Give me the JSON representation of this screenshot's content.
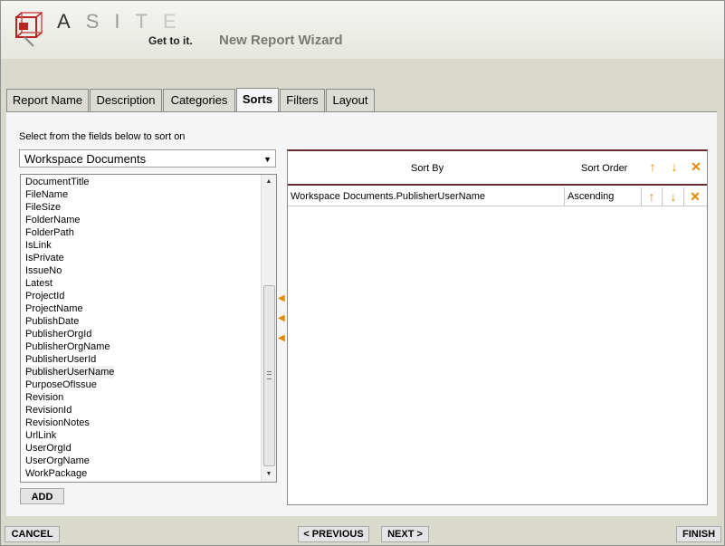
{
  "header": {
    "logo_letters": [
      "A",
      "S",
      "I",
      "T",
      "E"
    ],
    "tagline": "Get to it.",
    "wizard_title": "New Report Wizard"
  },
  "tabs": [
    {
      "label": "Report Name",
      "active": false
    },
    {
      "label": "Description",
      "active": false
    },
    {
      "label": "Categories",
      "active": false
    },
    {
      "label": "Sorts",
      "active": true
    },
    {
      "label": "Filters",
      "active": false
    },
    {
      "label": "Layout",
      "active": false
    }
  ],
  "sorts": {
    "instruction": "Select from the fields below to sort on",
    "source_select": "Workspace Documents",
    "fields": [
      "DocumentTitle",
      "FileName",
      "FileSize",
      "FolderName",
      "FolderPath",
      "IsLink",
      "IsPrivate",
      "IssueNo",
      "Latest",
      "ProjectId",
      "ProjectName",
      "PublishDate",
      "PublisherOrgId",
      "PublisherOrgName",
      "PublisherUserId",
      "PublisherUserName",
      "PurposeOfIssue",
      "Revision",
      "RevisionId",
      "RevisionNotes",
      "UrlLink",
      "UserOrgId",
      "UserOrgName",
      "WorkPackage"
    ],
    "selected_field": "PublisherUserName",
    "add_label": "ADD",
    "columns": {
      "sort_by": "Sort By",
      "sort_order": "Sort Order"
    },
    "rows": [
      {
        "sort_by": "Workspace Documents.PublisherUserName",
        "sort_order": "Ascending"
      }
    ]
  },
  "footer": {
    "cancel": "CANCEL",
    "previous": "< PREVIOUS",
    "next": "NEXT >",
    "finish": "FINISH"
  },
  "colors": {
    "accent_arrow": "#e08a00",
    "header_rule": "#6b2a2a"
  }
}
